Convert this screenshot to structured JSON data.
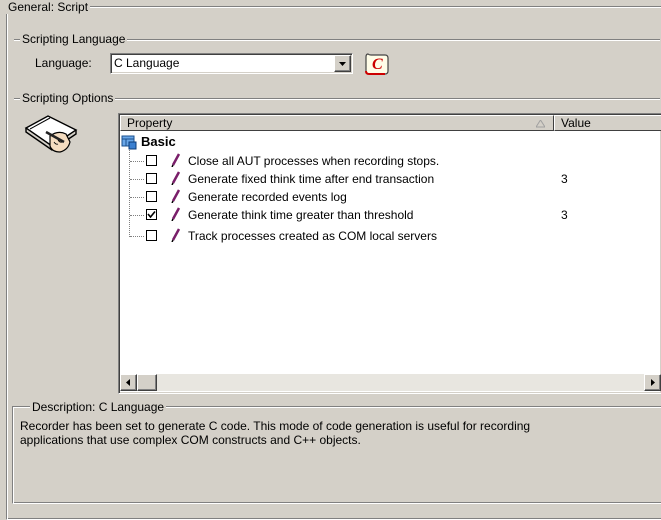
{
  "group_general": {
    "label": "General: Script"
  },
  "group_language": {
    "label": "Scripting Language",
    "field_label": "Language:",
    "selected": "C Language"
  },
  "group_options": {
    "label": "Scripting Options"
  },
  "table": {
    "columns": [
      "Property",
      "Value"
    ],
    "category": "Basic",
    "rows": [
      {
        "label": "Close all AUT processes when recording stops.",
        "value": "",
        "checked": false
      },
      {
        "label": "Generate fixed think time after end transaction",
        "value": "3",
        "checked": false
      },
      {
        "label": "Generate recorded events log",
        "value": "",
        "checked": false
      },
      {
        "label": "Generate think time greater than threshold",
        "value": "3",
        "checked": true
      },
      {
        "label": "Track processes created as COM local servers",
        "value": "",
        "checked": false
      }
    ]
  },
  "description": {
    "label": "Description: C Language",
    "line1": "Recorder has been set to generate C code.  This mode of code generation is useful for recording",
    "line2": "applications that use complex COM constructs and C++ objects."
  },
  "icons": {
    "dropdown": "chevron-down-icon",
    "script_language": "script-c-icon",
    "options_hand": "hand-notebook-icon",
    "category": "property-grid-icon",
    "row": "pencil-icon",
    "sort": "sort-asc-icon"
  },
  "colors": {
    "background": "#d4d0c8",
    "c_icon_red": "#cc0000"
  }
}
